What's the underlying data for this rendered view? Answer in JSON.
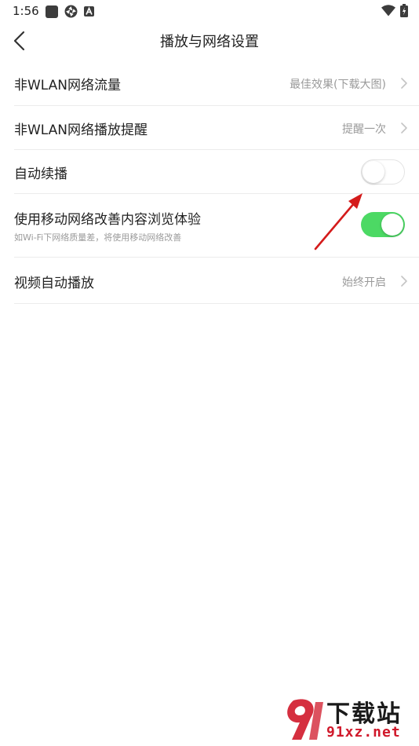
{
  "status_bar": {
    "time": "1:56"
  },
  "header": {
    "title": "播放与网络设置"
  },
  "settings": [
    {
      "label": "非WLAN网络流量",
      "value": "最佳效果(下载大图)"
    },
    {
      "label": "非WLAN网络播放提醒",
      "value": "提醒一次"
    },
    {
      "label": "自动续播",
      "toggle": "off"
    },
    {
      "label": "使用移动网络改善内容浏览体验",
      "subtitle": "如Wi-Fi下网络质量差，将使用移动网络改善",
      "toggle": "on"
    },
    {
      "label": "视频自动播放",
      "value": "始终开启"
    }
  ],
  "colors": {
    "toggle_on": "#4cd964",
    "annotation_arrow": "#d41b1b",
    "watermark_red": "#d0182a"
  },
  "watermark": {
    "cn": "下载站",
    "domain": "91xz.net"
  }
}
